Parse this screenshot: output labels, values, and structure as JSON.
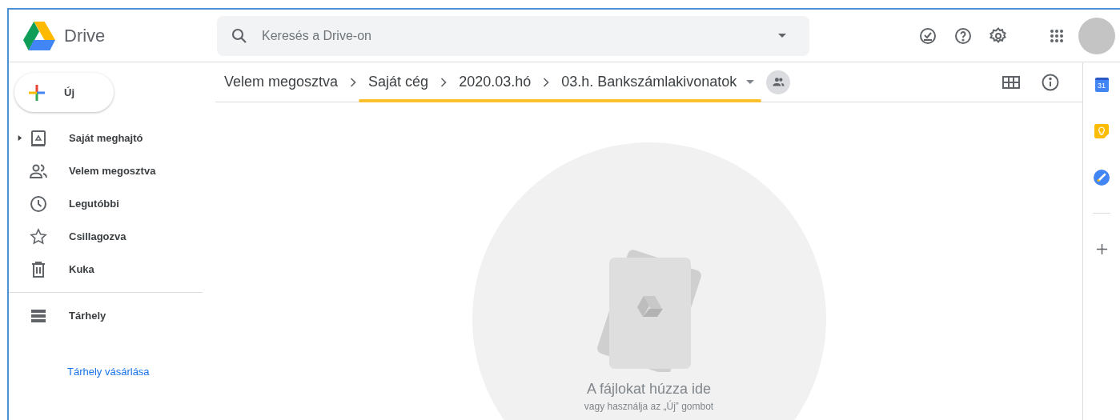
{
  "header": {
    "app_name": "Drive",
    "search": {
      "placeholder": "Keresés a Drive-on"
    }
  },
  "new_button": {
    "label": "Új"
  },
  "sidebar": {
    "items": [
      {
        "kind": "drive",
        "label": "Saját meghajtó",
        "expanded": false,
        "selected": false
      },
      {
        "kind": "shared",
        "label": "Velem megosztva",
        "selected": false
      },
      {
        "kind": "recent",
        "label": "Legutóbbi",
        "selected": false
      },
      {
        "kind": "starred",
        "label": "Csillagozva",
        "selected": false
      },
      {
        "kind": "trash",
        "label": "Kuka",
        "selected": false
      },
      {
        "kind": "storage",
        "label": "Tárhely",
        "selected": false
      }
    ],
    "buy_storage_link": "Tárhely vásárlása"
  },
  "breadcrumb": {
    "items": [
      {
        "label": "Velem megosztva",
        "highlighted": false
      },
      {
        "label": "Saját cég",
        "highlighted": true
      },
      {
        "label": "2020.03.hó",
        "highlighted": true
      },
      {
        "label": "03.h. Bankszámlakivonatok",
        "highlighted": true
      }
    ],
    "shared": true
  },
  "empty_state": {
    "title": "A fájlokat húzza ide",
    "subtitle": "vagy használja az „Új” gombot"
  },
  "side_panel": {
    "calendar_day": "31"
  }
}
